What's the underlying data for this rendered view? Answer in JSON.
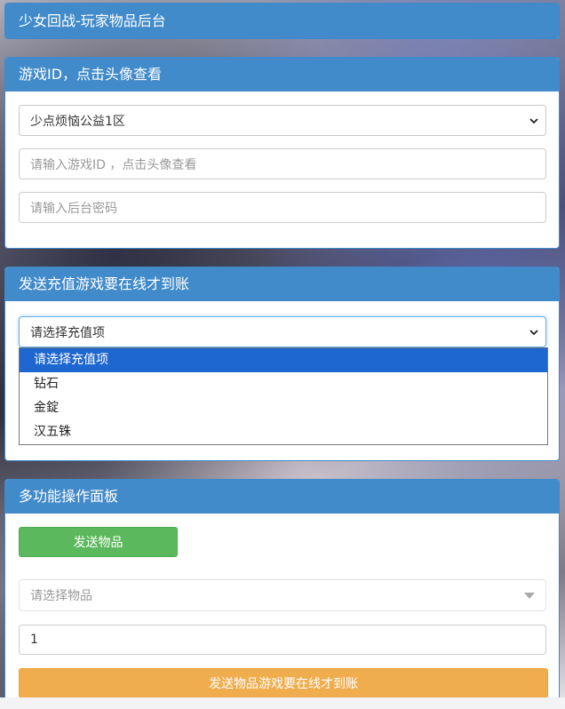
{
  "header": {
    "title": "少女回战-玩家物品后台"
  },
  "panel1": {
    "title": "游戏ID，点击头像查看",
    "server_select": {
      "value": "少点烦恼公益1区"
    },
    "game_id_input": {
      "placeholder": "请输入游戏ID ，点击头像查看"
    },
    "password_input": {
      "placeholder": "请输入后台密码"
    }
  },
  "panel2": {
    "title": "发送充值游戏要在线才到账",
    "recharge_select": {
      "value": "请选择充值项"
    },
    "options": [
      "请选择充值项",
      "钻石",
      "金錠",
      "汉五铢"
    ],
    "selected_index": 0
  },
  "panel3": {
    "title": "多功能操作面板",
    "send_button": "发送物品",
    "item_select": {
      "placeholder": "请选择物品"
    },
    "quantity_input": {
      "value": "1"
    },
    "submit_button": "发送物品游戏要在线才到账"
  }
}
